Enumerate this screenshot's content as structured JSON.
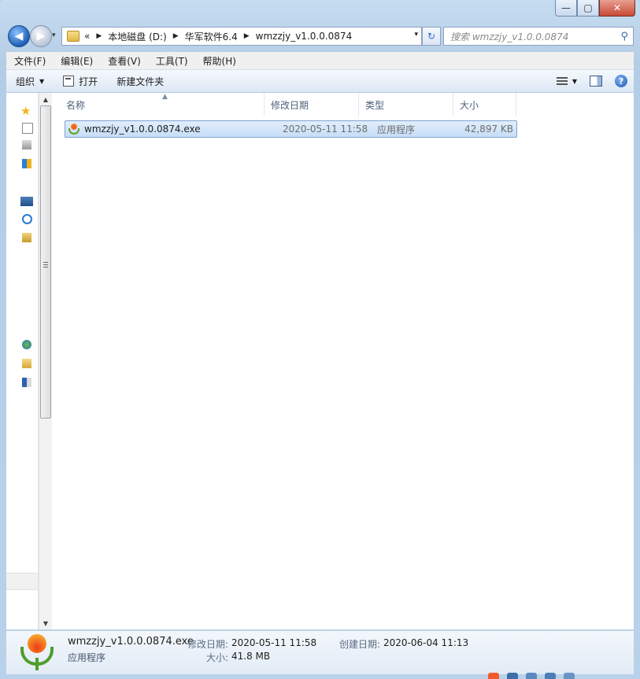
{
  "window": {
    "min_label": "—",
    "max_label": "▢",
    "close_label": "✕"
  },
  "nav": {
    "back_glyph": "◀",
    "forward_glyph": "▶",
    "history_glyph": "▾",
    "refresh_glyph": "↻",
    "address": {
      "overflow": "«",
      "crumbs": [
        "本地磁盘 (D:)",
        "华军软件6.4",
        "wmzzjy_v1.0.0.0874"
      ],
      "dropdown_glyph": "▾"
    },
    "search": {
      "placeholder": "搜索 wmzzjy_v1.0.0.0874",
      "icon": "search-icon"
    }
  },
  "menu": [
    "文件(F)",
    "编辑(E)",
    "查看(V)",
    "工具(T)",
    "帮助(H)"
  ],
  "toolbar": {
    "organize": "组织",
    "open": "打开",
    "new_folder": "新建文件夹"
  },
  "columns": {
    "name": "名称",
    "modified": "修改日期",
    "type": "类型",
    "size": "大小"
  },
  "files": [
    {
      "name": "wmzzjy_v1.0.0.0874.exe",
      "modified": "2020-05-11 11:58",
      "type": "应用程序",
      "size": "42,897 KB",
      "selected": true
    }
  ],
  "details": {
    "filename": "wmzzjy_v1.0.0.0874.exe",
    "filetype": "应用程序",
    "modified_label": "修改日期:",
    "modified_value": "2020-05-11 11:58",
    "size_label": "大小:",
    "size_value": "41.8 MB",
    "created_label": "创建日期:",
    "created_value": "2020-06-04 11:13"
  },
  "colors": {
    "selection": "#cce1f8",
    "accent": "#1c58b3"
  }
}
